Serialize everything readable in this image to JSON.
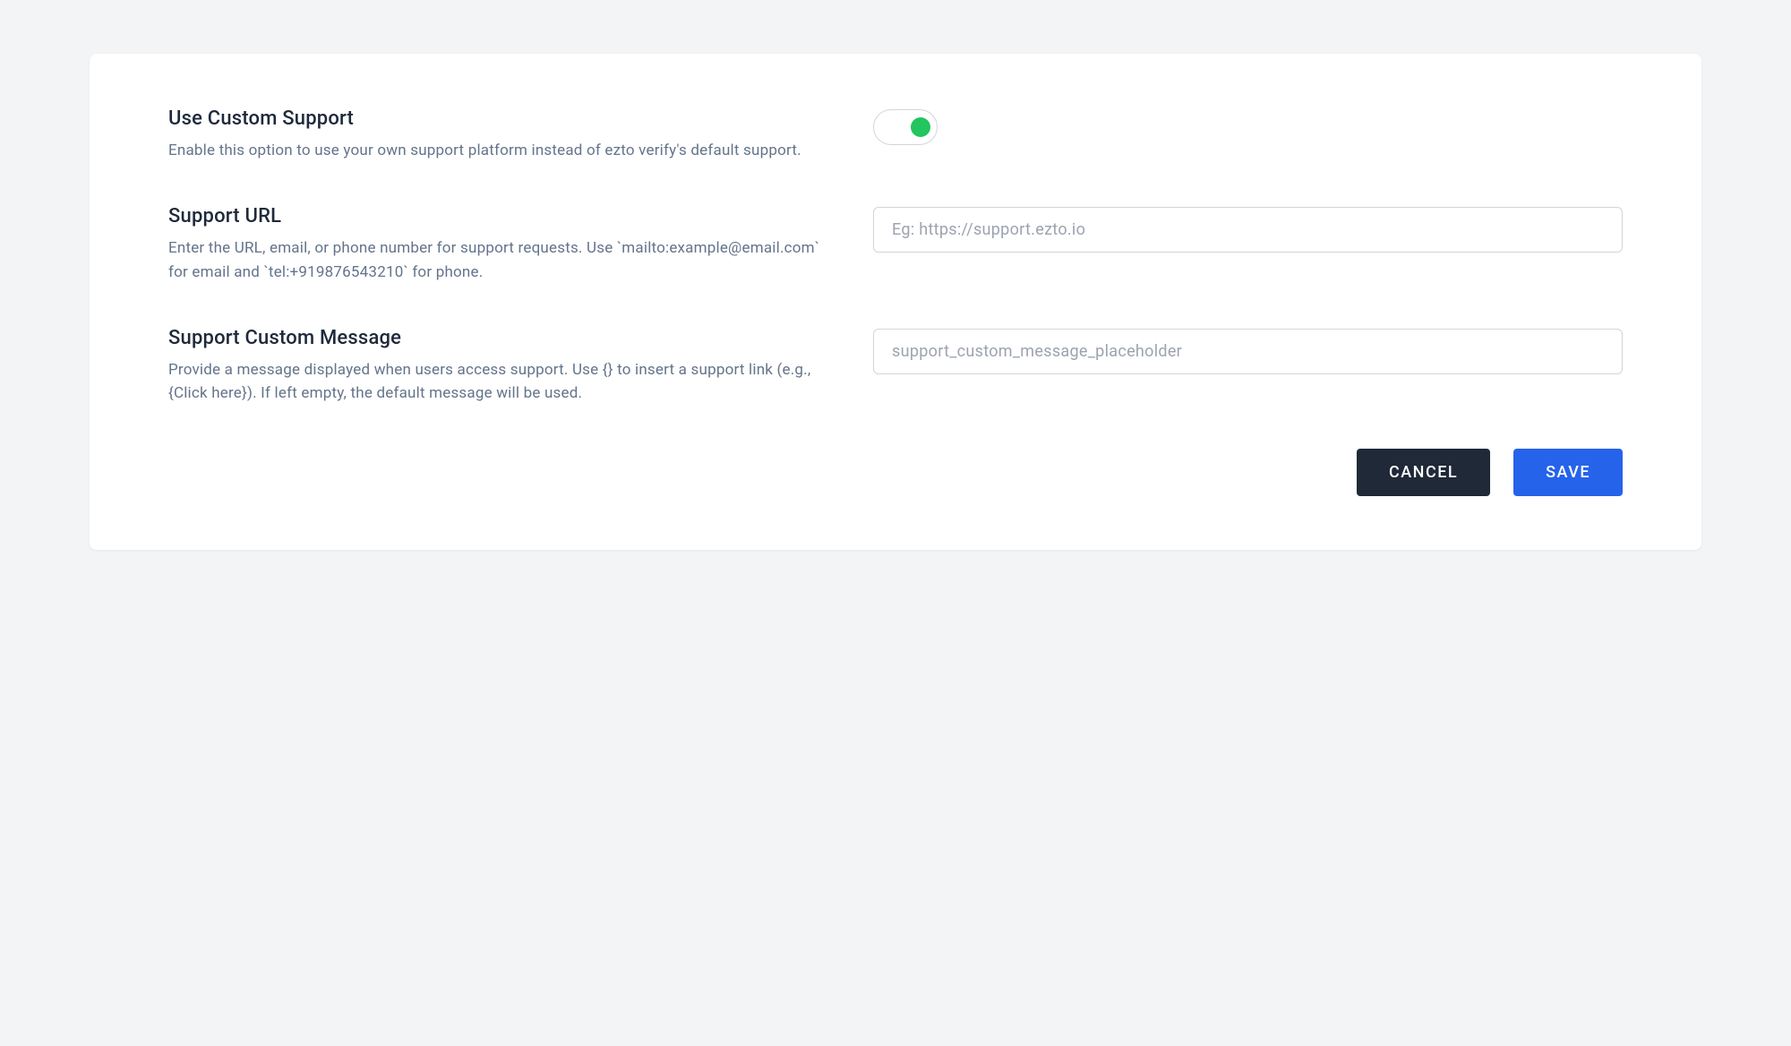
{
  "fields": {
    "use_custom_support": {
      "title": "Use Custom Support",
      "description": "Enable this option to use your own support platform instead of ezto verify's default support.",
      "enabled": true
    },
    "support_url": {
      "title": "Support URL",
      "description": "Enter the URL, email, or phone number for support requests. Use `mailto:example@email.com` for email and `tel:+919876543210` for phone.",
      "value": "",
      "placeholder": "Eg: https://support.ezto.io"
    },
    "support_custom_message": {
      "title": "Support Custom Message",
      "description": "Provide a message displayed when users access support. Use {} to insert a support link (e.g., {Click here}). If left empty, the default message will be used.",
      "value": "",
      "placeholder": "support_custom_message_placeholder"
    }
  },
  "buttons": {
    "cancel": "CANCEL",
    "save": "SAVE"
  }
}
